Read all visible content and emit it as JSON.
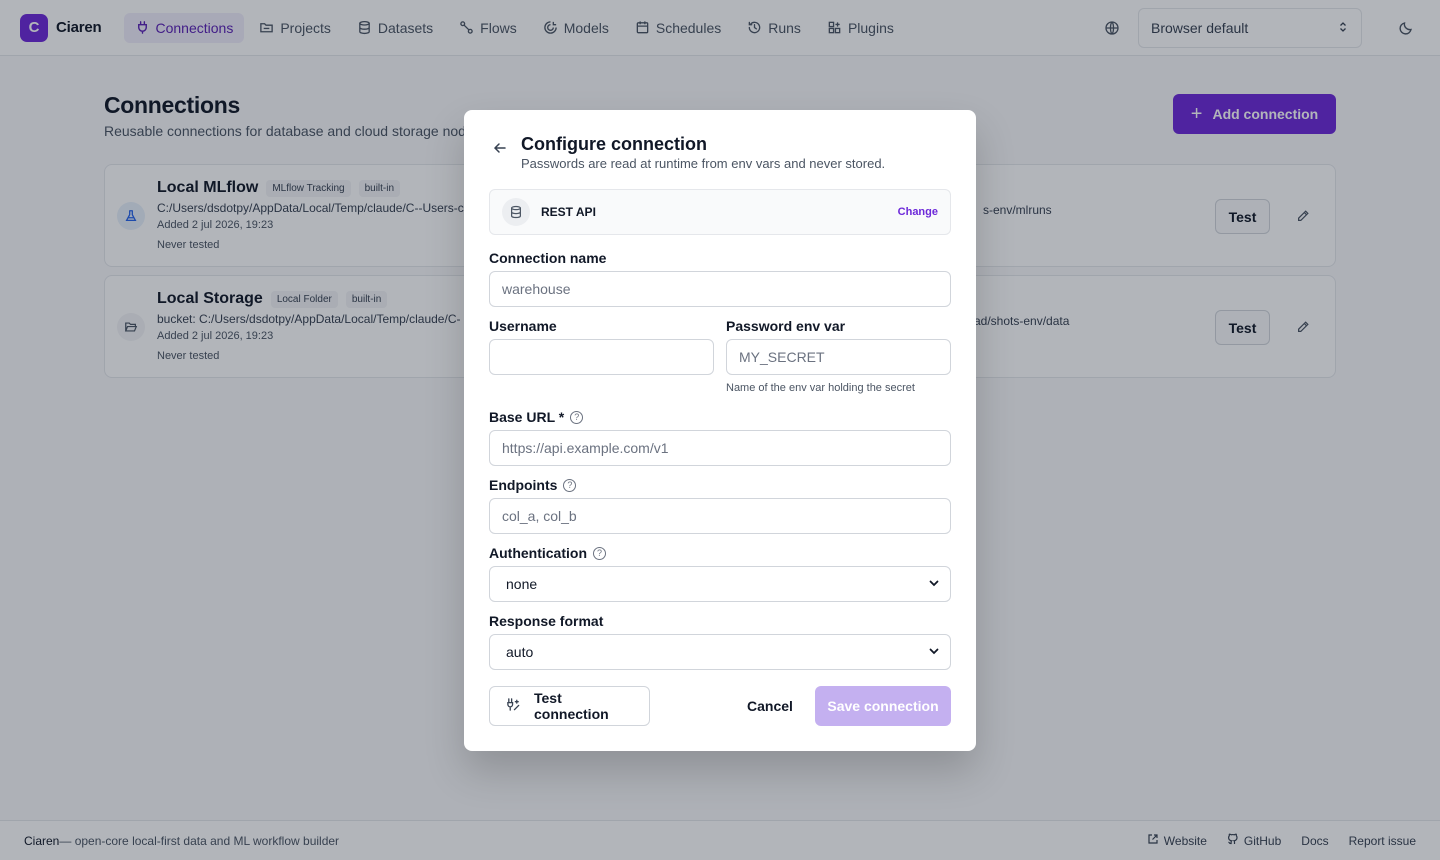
{
  "app": {
    "logo_letter": "C",
    "name": "Ciaren"
  },
  "nav": {
    "items": [
      {
        "label": "Connections",
        "icon": "plug-icon",
        "active": true
      },
      {
        "label": "Projects",
        "icon": "folder-icon"
      },
      {
        "label": "Datasets",
        "icon": "database-icon"
      },
      {
        "label": "Flows",
        "icon": "flow-icon"
      },
      {
        "label": "Models",
        "icon": "model-icon"
      },
      {
        "label": "Schedules",
        "icon": "calendar-icon"
      },
      {
        "label": "Runs",
        "icon": "history-icon"
      },
      {
        "label": "Plugins",
        "icon": "puzzle-icon"
      }
    ]
  },
  "header": {
    "language_value": "Browser default"
  },
  "page": {
    "title": "Connections",
    "subtitle": "Reusable connections for database and cloud storage nod",
    "add_button": "Add connection"
  },
  "connections": [
    {
      "name": "Local MLflow",
      "badges": [
        "MLflow Tracking",
        "built-in"
      ],
      "path": "C:/Users/dsdotpy/AppData/Local/Temp/claude/C--Users-c",
      "path_tail": "s-env/mlruns",
      "added": "Added 2 jul 2026, 19:23",
      "tested": "Never tested",
      "test_label": "Test",
      "icon": "flask-icon"
    },
    {
      "name": "Local Storage",
      "badges": [
        "Local Folder",
        "built-in"
      ],
      "path": "bucket: C:/Users/dsdotpy/AppData/Local/Temp/claude/C-",
      "path_tail": "ad/shots-env/data",
      "added": "Added 2 jul 2026, 19:23",
      "tested": "Never tested",
      "test_label": "Test",
      "icon": "folder-open-icon"
    }
  ],
  "modal": {
    "title": "Configure connection",
    "subtitle": "Passwords are read at runtime from env vars and never stored.",
    "type": {
      "label": "REST API",
      "change": "Change"
    },
    "fields": {
      "connection_name": {
        "label": "Connection name",
        "placeholder": "warehouse"
      },
      "username": {
        "label": "Username",
        "placeholder": ""
      },
      "password_env": {
        "label": "Password env var",
        "placeholder": "MY_SECRET",
        "hint": "Name of the env var holding the secret"
      },
      "base_url": {
        "label": "Base URL *",
        "placeholder": "https://api.example.com/v1"
      },
      "endpoints": {
        "label": "Endpoints",
        "placeholder": "col_a, col_b"
      },
      "authentication": {
        "label": "Authentication",
        "value": "none"
      },
      "response_format": {
        "label": "Response format",
        "value": "auto"
      }
    },
    "help_glyph": "?",
    "buttons": {
      "test": "Test connection",
      "cancel": "Cancel",
      "save": "Save connection"
    }
  },
  "footer": {
    "brand": "Ciaren",
    "tagline": " — open-core local-first data and ML workflow builder",
    "links": [
      "Website",
      "GitHub",
      "Docs",
      "Report issue"
    ]
  },
  "colors": {
    "accent": "#6d28d9",
    "accent_disabled": "#c4b0f0",
    "nav_active_bg": "#f1edfb"
  }
}
